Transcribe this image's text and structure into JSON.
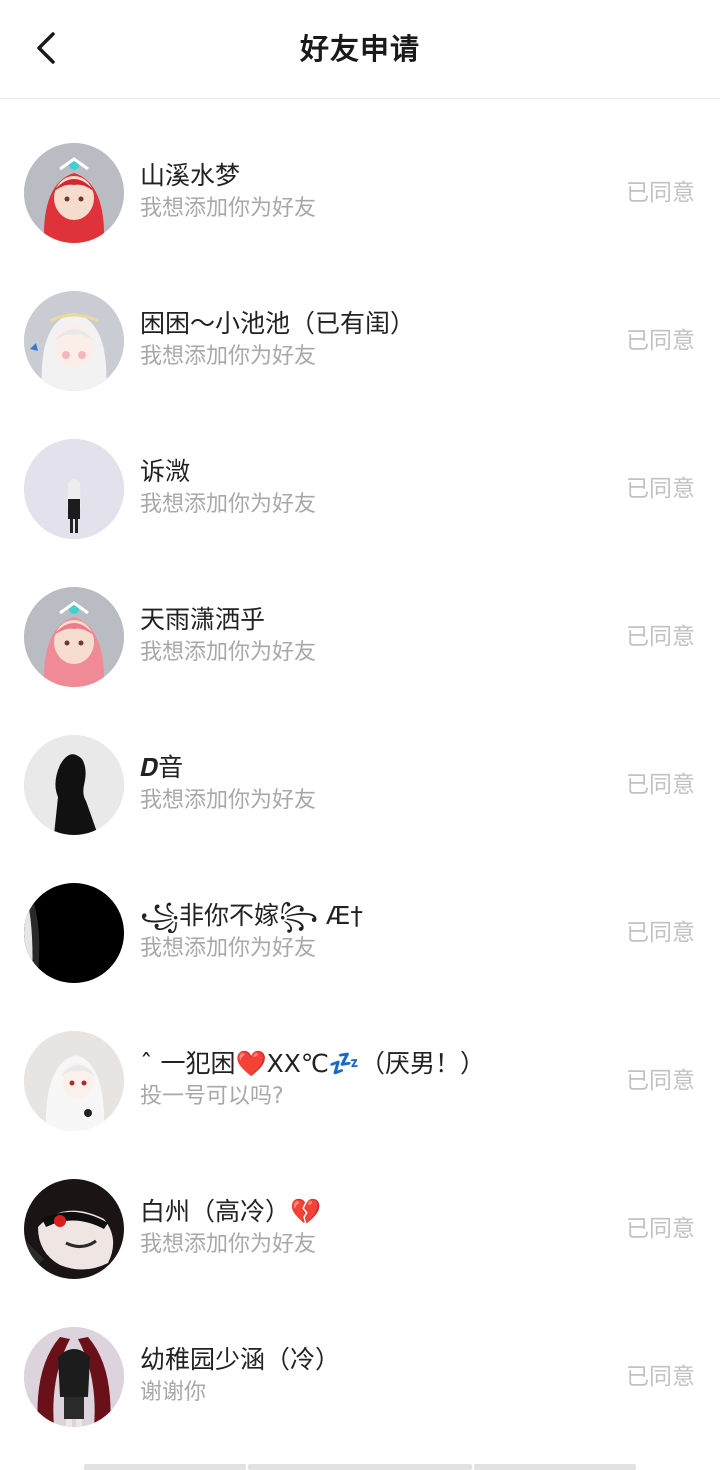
{
  "header": {
    "title": "好友申请"
  },
  "requests": [
    {
      "name": "山溪水梦",
      "message": "我想添加你为好友",
      "status": "已同意"
    },
    {
      "name": "困困～小池池（已有闺）",
      "message": "我想添加你为好友",
      "status": "已同意"
    },
    {
      "name": "诉溦",
      "message": "我想添加你为好友",
      "status": "已同意"
    },
    {
      "name": "天雨潇洒乎",
      "message": "我想添加你为好友",
      "status": "已同意"
    },
    {
      "name": "𝑫音",
      "message": "我想添加你为好友",
      "status": "已同意"
    },
    {
      "name": "꧁非你不嫁꧂ Æ†",
      "message": "我想添加你为好友",
      "status": "已同意"
    },
    {
      "name": "ˆ 一犯困❤️XX℃💤（厌男！）",
      "message": "投一号可以吗?",
      "status": "已同意"
    },
    {
      "name": "白州（高冷）💔",
      "message": "我想添加你为好友",
      "status": "已同意"
    },
    {
      "name": "幼稚园少涵（冷）",
      "message": "谢谢你",
      "status": "已同意"
    }
  ]
}
